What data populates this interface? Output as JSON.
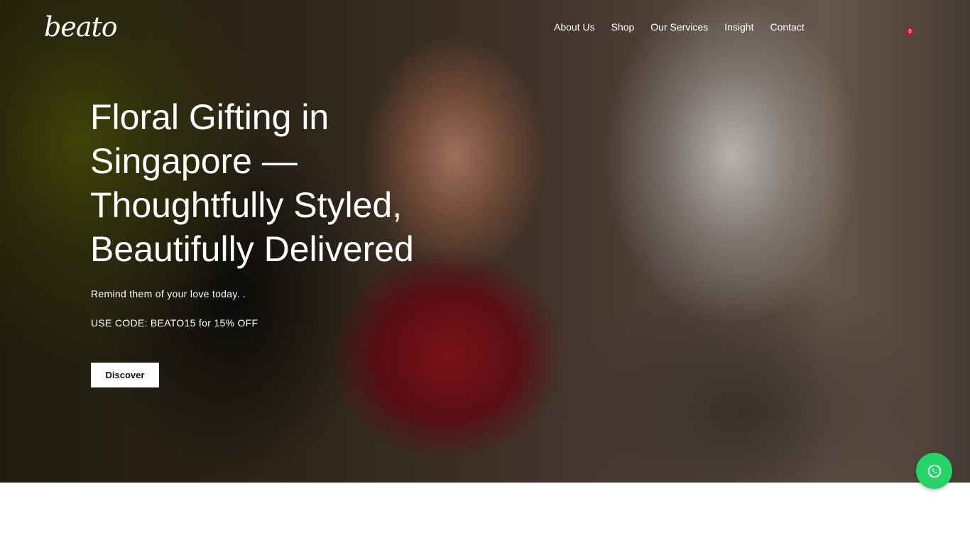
{
  "brand": {
    "logo_text": "beato"
  },
  "nav": {
    "items": [
      {
        "label": "About Us"
      },
      {
        "label": "Shop"
      },
      {
        "label": "Our Services"
      },
      {
        "label": "Insight"
      },
      {
        "label": "Contact"
      }
    ]
  },
  "cart": {
    "count": "0",
    "icon": "shopping-bag-icon"
  },
  "hero": {
    "headline": "Floral Gifting in Singapore — Thoughtfully Styled, Beautifully Delivered",
    "subtext": "Remind them of your love today. .",
    "promo": "USE CODE: BEATO15 for 15% OFF",
    "cta_label": "Discover"
  },
  "whatsapp": {
    "icon": "whatsapp-icon",
    "color": "#25d366"
  },
  "colors": {
    "badge": "#c8102e",
    "button_bg": "#ffffff",
    "text_on_hero": "#ffffff"
  }
}
